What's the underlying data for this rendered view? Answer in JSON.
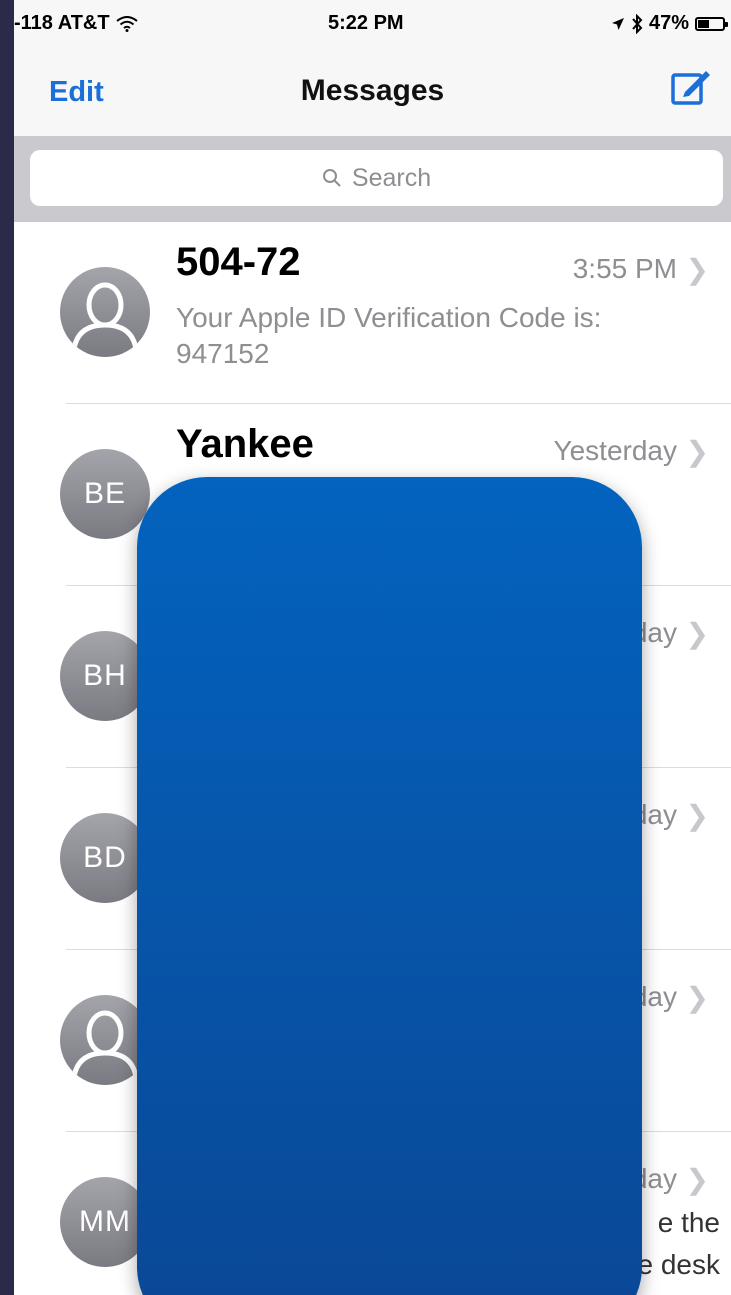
{
  "status_bar": {
    "carrier": "-118 AT&T",
    "time": "5:22 PM",
    "battery": "47%",
    "battery_level": 0.47
  },
  "nav": {
    "edit_label": "Edit",
    "title": "Messages",
    "compose_icon": "compose-icon"
  },
  "search": {
    "placeholder": "Search"
  },
  "conversations": [
    {
      "name": "504-72",
      "time": "3:55 PM",
      "preview": "Your Apple ID Verification Code is: 947152",
      "avatar": "person-silhouette"
    },
    {
      "name": "Yankee",
      "time": "Yesterday",
      "preview": "",
      "initials": "BE"
    },
    {
      "name": "",
      "time": "day",
      "preview": "",
      "initials": "BH"
    },
    {
      "name": "",
      "time": "day",
      "preview": "",
      "initials": "BD"
    },
    {
      "name": "",
      "time": "day",
      "preview": "",
      "avatar": "person-silhouette"
    },
    {
      "name": "",
      "time": "day",
      "preview": "e the\ne desk",
      "initials": "MM"
    }
  ],
  "colors": {
    "accent": "#1a6fd8",
    "redaction": "#0a58b0",
    "background": "#2a2b48"
  }
}
